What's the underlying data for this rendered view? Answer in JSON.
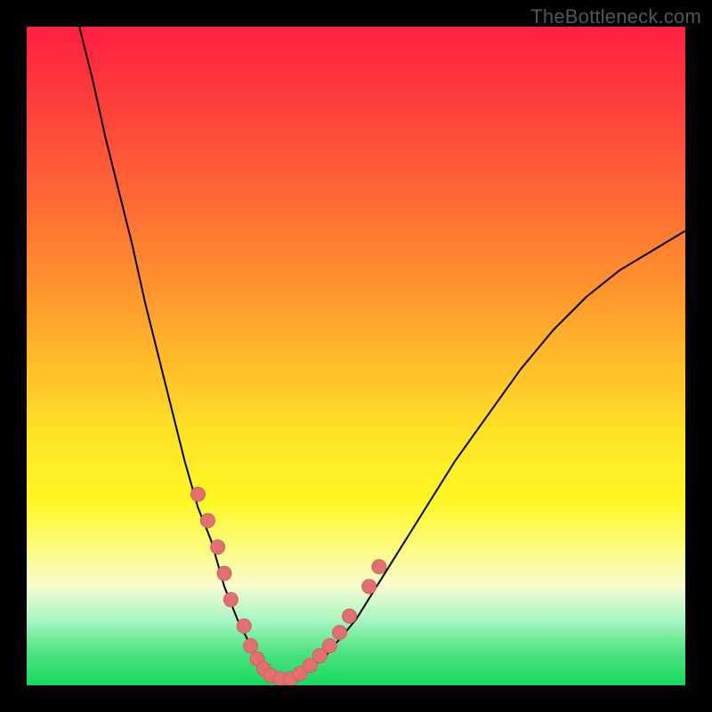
{
  "watermark": "TheBottleneck.com",
  "colors": {
    "frame": "#000000",
    "curve": "#000000",
    "marker_fill": "#e27070",
    "marker_stroke": "#cf5f5f"
  },
  "chart_data": {
    "type": "line",
    "title": "",
    "xlabel": "",
    "ylabel": "",
    "xlim": [
      0,
      100
    ],
    "ylim": [
      0,
      100
    ],
    "grid": false,
    "legend": false,
    "series": [
      {
        "name": "bottleneck-curve",
        "x": [
          8,
          10,
          12,
          14,
          16,
          18,
          20,
          22,
          24,
          26,
          28,
          30,
          32,
          34,
          36,
          38,
          40,
          45,
          50,
          55,
          60,
          65,
          70,
          75,
          80,
          85,
          90,
          95,
          100
        ],
        "values": [
          100,
          92,
          83,
          75,
          67,
          58,
          50,
          42,
          34,
          27,
          22,
          15,
          10,
          6,
          3,
          1,
          1,
          4,
          10,
          18,
          26,
          34,
          41,
          48,
          54,
          59,
          63,
          66,
          69
        ]
      }
    ],
    "markers": {
      "name": "highlighted-points",
      "x": [
        26,
        27.5,
        29,
        30,
        31,
        33,
        34,
        35,
        36,
        37,
        38.5,
        40,
        41.5,
        43,
        44.5,
        46,
        47.5,
        49,
        52,
        53.5
      ],
      "values": [
        29,
        25,
        21,
        17,
        13,
        9,
        6,
        4,
        2.5,
        1.5,
        1,
        1,
        1.8,
        3,
        4.5,
        6,
        8,
        10.5,
        15,
        18
      ]
    }
  }
}
